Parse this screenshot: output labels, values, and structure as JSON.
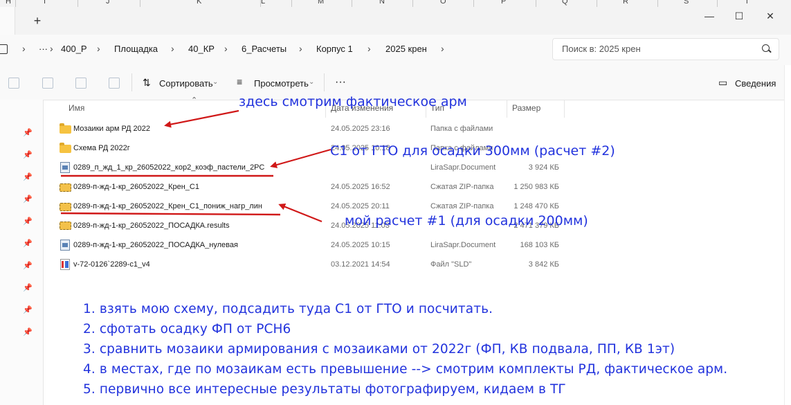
{
  "excel_columns": [
    "H",
    "I",
    "J",
    "K",
    "L",
    "M",
    "N",
    "O",
    "P",
    "Q",
    "R",
    "S",
    "T"
  ],
  "window": {
    "new_tab_label": "+",
    "minimize": "—",
    "maximize": "☐",
    "close": "✕"
  },
  "breadcrumb": {
    "overflow": "···",
    "items": [
      "400_Р",
      "Площадка",
      "40_КР",
      "6_Расчеты",
      "Корпус 1",
      "2025 крен"
    ],
    "separator": "›"
  },
  "search": {
    "placeholder": "Поиск в: 2025 крен"
  },
  "toolbar": {
    "sort_label": "Сортировать",
    "view_label": "Просмотреть",
    "more_label": "···",
    "details_label": "Сведения"
  },
  "columns": {
    "name": "Имя",
    "date": "Дата изменения",
    "type": "Тип",
    "size": "Размер"
  },
  "files": [
    {
      "name": "Мозаики арм РД 2022",
      "date": "24.05.2025 23:16",
      "type": "Папка с файлами",
      "size": "",
      "icon": "folder-icon"
    },
    {
      "name": "Схема РД 2022г",
      "date": "24.05.2025 10:18",
      "type": "Папка с файлами",
      "size": "",
      "icon": "folder-icon"
    },
    {
      "name": "0289_п_жд_1_кр_26052022_кор2_коэф_пастели_2РС",
      "date": "",
      "type": "LiraSapr.Document",
      "size": "3 924 КБ",
      "icon": "lira-document-icon"
    },
    {
      "name": "0289-п-жд-1-кр_26052022_Крен_С1",
      "date": "24.05.2025 16:52",
      "type": "Сжатая ZIP-папка",
      "size": "1 250 983 КБ",
      "icon": "zip-folder-icon"
    },
    {
      "name": "0289-п-жд-1-кр_26052022_Крен_С1_пониж_нагр_лин",
      "date": "24.05.2025 20:11",
      "type": "Сжатая ZIP-папка",
      "size": "1 248 470 КБ",
      "icon": "zip-folder-icon"
    },
    {
      "name": "0289-п-жд-1-кр_26052022_ПОСАДКА.results",
      "date": "24.05.2025 11:03",
      "type": "",
      "size": "2 471 379 КБ",
      "icon": "zip-folder-icon"
    },
    {
      "name": "0289-п-жд-1-кр_26052022_ПОСАДКА_нулевая",
      "date": "24.05.2025 10:15",
      "type": "LiraSapr.Document",
      "size": "168 103 КБ",
      "icon": "lira-document-icon"
    },
    {
      "name": "v-72-0126`2289-c1_v4",
      "date": "03.12.2021 14:54",
      "type": "Файл \"SLD\"",
      "size": "3 842 КБ",
      "icon": "sld-file-icon"
    }
  ],
  "annotations": {
    "a1": "здесь смотрим фактическое арм",
    "a2": "С1 от ГТО для осадки 300мм (расчет #2)",
    "a3": "мой расчет #1 (для осадки 200мм)"
  },
  "notes": [
    "1. взять мою схему, подсадить туда С1 от ГТО и посчитать.",
    "2. сфотать осадку ФП от РСН6",
    "3. сравнить мозаики армирования с мозаиками от 2022г (ФП, КВ подвала, ПП, КВ 1эт)",
    "4. в местах, где по мозаикам есть превышение --> смотрим комплекты РД, фактическое арм.",
    "5. первично все интересные результаты фотографируем, кидаем в ТГ"
  ],
  "colors": {
    "annotation": "#2233dd",
    "arrow": "#d01818"
  }
}
